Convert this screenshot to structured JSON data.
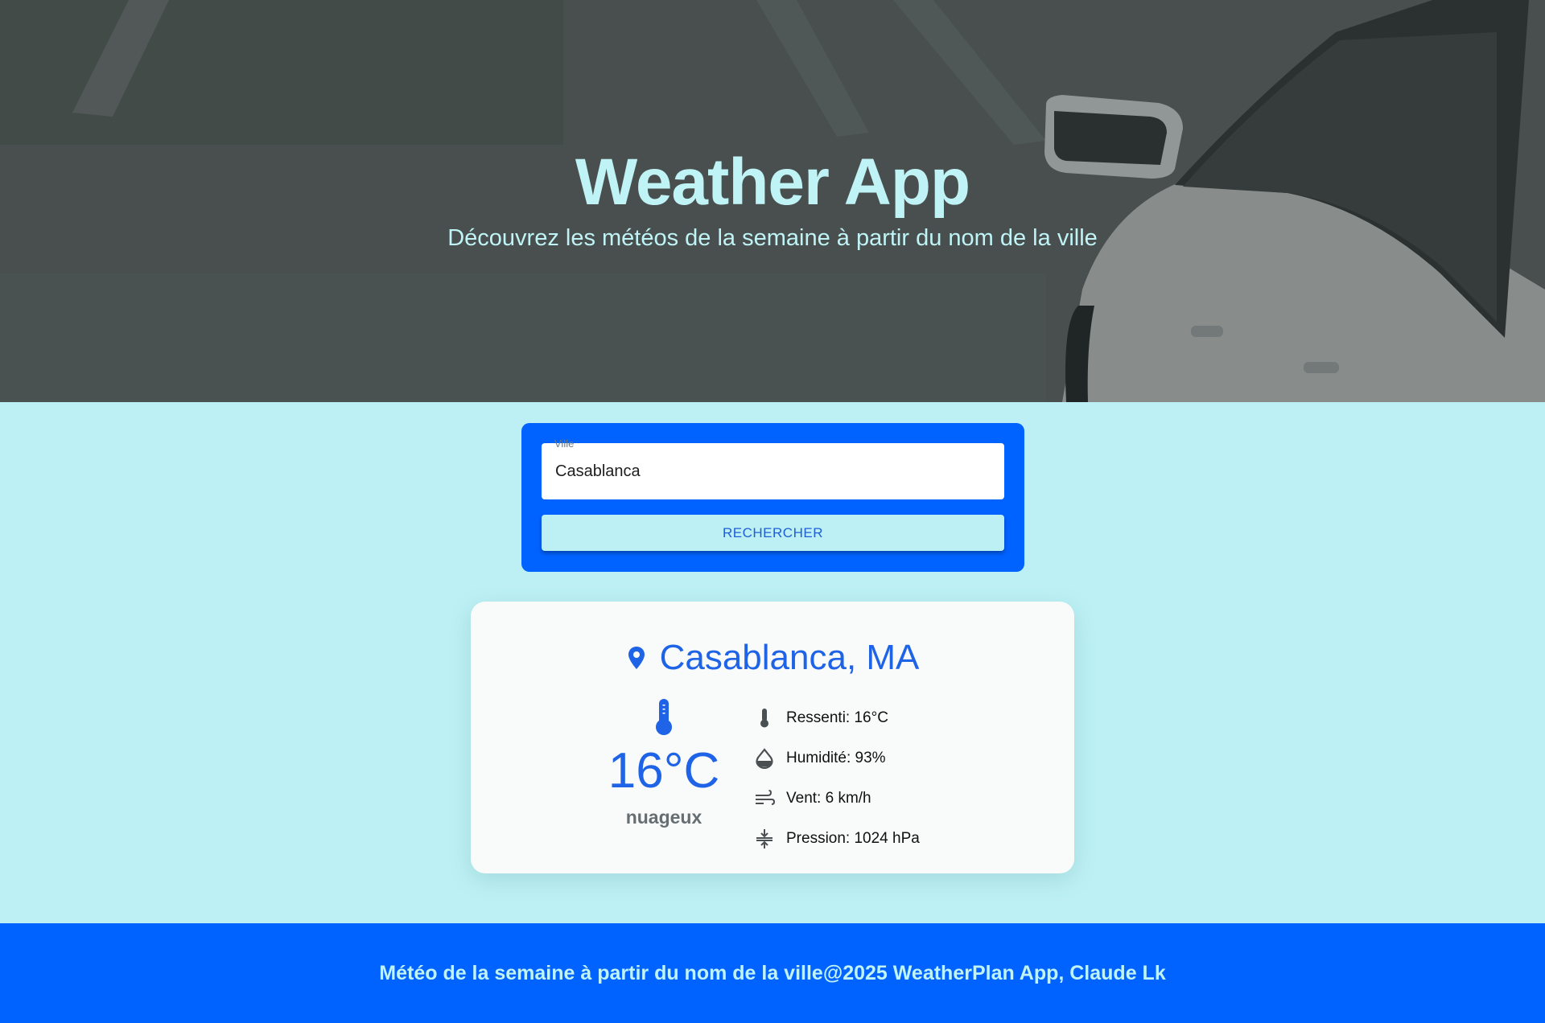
{
  "hero": {
    "title": "Weather App",
    "subtitle": "Découvrez les météos de la semaine à partir du nom de la ville"
  },
  "search": {
    "field_label": "Ville",
    "field_value": "Casablanca",
    "button_label": "RECHERCHER"
  },
  "weather": {
    "location": "Casablanca, MA",
    "location_icon": "map-pin-icon",
    "temperature": "16°C",
    "temperature_icon": "thermometer-icon",
    "condition": "nuageux",
    "details": [
      {
        "icon": "thermometer-icon",
        "text": "Ressenti: 16°C"
      },
      {
        "icon": "water-drop-icon",
        "text": "Humidité: 93%"
      },
      {
        "icon": "wind-icon",
        "text": "Vent: 6 km/h"
      },
      {
        "icon": "pressure-icon",
        "text": "Pression: 1024 hPa"
      }
    ]
  },
  "footer": {
    "text": "Météo de la semaine à partir du nom de la ville@2025 WeatherPlan App, Claude Lk"
  },
  "colors": {
    "primary_blue": "#0062ff",
    "background_cyan": "#bcf0f4",
    "accent_text_blue": "#1f63e6",
    "hero_text": "#bff3f5"
  }
}
